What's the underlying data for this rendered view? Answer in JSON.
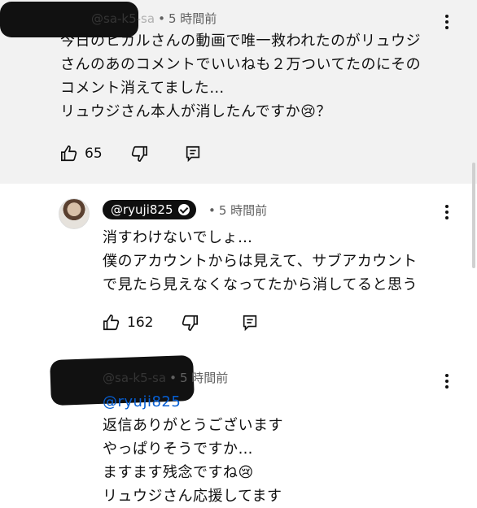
{
  "comments": [
    {
      "handle": "@sa-k5-sa",
      "time": "5 時間前",
      "lines": [
        "今日のヒカルさんの動画で唯一救われたのがリュウジ",
        "さんのあのコメントでいいねも２万ついてたのにその",
        "コメント消えてました…",
        "リュウジさん本人が消したんですか😢？"
      ],
      "likes": "65",
      "highlighted": true
    },
    {
      "handle": "@ryuji825",
      "time": "5 時間前",
      "verified": true,
      "lines": [
        "消すわけないでしょ…",
        "僕のアカウントからは見えて、サブアカウント",
        "で見たら見えなくなってたから消してると思う"
      ],
      "likes": "162"
    },
    {
      "handle": "@sa-k5-sa",
      "time": "5 時間前",
      "mention": "@ryuji825",
      "lines": [
        "返信ありがとうございます",
        "やっぱりそうですか…",
        "ますます残念ですね😢",
        "リュウジさん応援してます"
      ]
    }
  ],
  "icons": {
    "like": "thumbs-up-icon",
    "dislike": "thumbs-down-icon",
    "reply": "reply-icon",
    "more": "more-vert-icon"
  }
}
